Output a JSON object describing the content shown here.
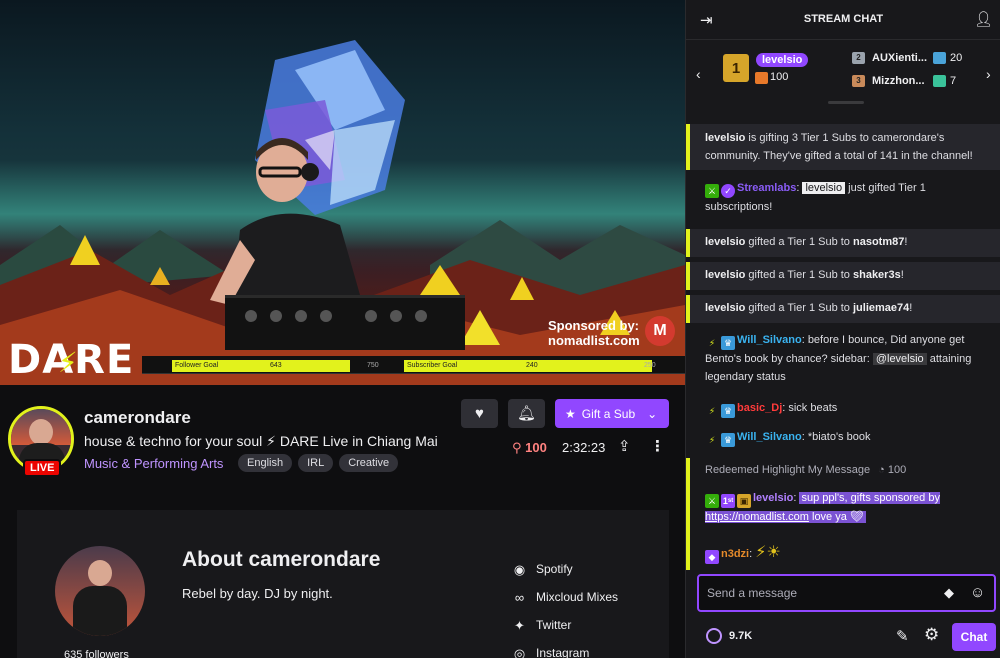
{
  "video": {
    "logo_text": "DARE",
    "follower_goal": {
      "label": "Follower Goal",
      "current": "643",
      "max": "750",
      "progress": 0.857
    },
    "subscriber_goal": {
      "label": "Subscriber Goal",
      "current": "240",
      "max": "250",
      "progress": 0.96
    },
    "sponsor_line1": "Sponsored by:",
    "sponsor_line2": "nomadlist.com",
    "sponsor_icon": "M"
  },
  "channel": {
    "name": "camerondare",
    "title": "house & techno for your soul ⚡ DARE Live in Chiang Mai",
    "category": "Music & Performing Arts",
    "tags": [
      "English",
      "IRL",
      "Creative"
    ],
    "live_label": "LIVE",
    "viewers": "100",
    "uptime": "2:32:23",
    "gift_button": "Gift a Sub",
    "icons": {
      "follow": "heart-icon",
      "notify": "bell-icon",
      "share": "share-icon",
      "more": "more-vertical-icon"
    }
  },
  "about": {
    "title": "About camerondare",
    "bio": "Rebel by day. DJ by night.",
    "followers": "635 followers",
    "links": [
      {
        "label": "Spotify",
        "icon": "spotify-icon"
      },
      {
        "label": "Mixcloud Mixes",
        "icon": "mixcloud-icon"
      },
      {
        "label": "Twitter",
        "icon": "twitter-icon"
      },
      {
        "label": "Instagram",
        "icon": "instagram-icon"
      }
    ]
  },
  "chat": {
    "title": "STREAM CHAT",
    "leaderboard": {
      "top": {
        "rank": "1",
        "name": "levelsio",
        "count": "100"
      },
      "others": [
        {
          "rank": "2",
          "name": "AUXienti...",
          "count": "20"
        },
        {
          "rank": "3",
          "name": "Mizzhon...",
          "count": "7"
        }
      ]
    },
    "messages": {
      "m1_user": "levelsio",
      "m1_text": " is gifting 3 Tier 1 Subs to camerondare's community. They've gifted a total of 141 in the channel!",
      "m2_user": "Streamlabs",
      "m2_mention": "levelsio",
      "m2_text": " just gifted Tier 1 subscriptions!",
      "m3_user": "levelsio",
      "m3_text": " gifted a Tier 1 Sub to ",
      "m3_target": "nasotm87",
      "m4_user": "levelsio",
      "m4_text": " gifted a Tier 1 Sub to ",
      "m4_target": "shaker3s",
      "m5_user": "levelsio",
      "m5_text": " gifted a Tier 1 Sub to ",
      "m5_target": "juliemae74",
      "m6_user": "Will_Silvano",
      "m6_text": ": before I bounce, Did anyone get Bento's book by chance? sidebar: ",
      "m6_mention": "@levelsio",
      "m6_text2": " attaining legendary status",
      "m7_user": "basic_Dj",
      "m7_text": ": sick beats",
      "m8_user": "Will_Silvano",
      "m8_text": ": *biato's book",
      "m9_label": "Redeemed Highlight My Message",
      "m9_cost": "100",
      "m10_user": "levelsio",
      "m10_text": " sup ppl's, gifts sponsored by ",
      "m10_link": "https://nomadlist.com",
      "m10_text2": " love ya ",
      "m11_user": "n3dzi"
    },
    "input_placeholder": "Send a message",
    "points": "9.7K",
    "send_label": "Chat",
    "colors": {
      "accent": "#9147ff",
      "goal": "#e2f21c",
      "live": "#eb0400"
    }
  }
}
